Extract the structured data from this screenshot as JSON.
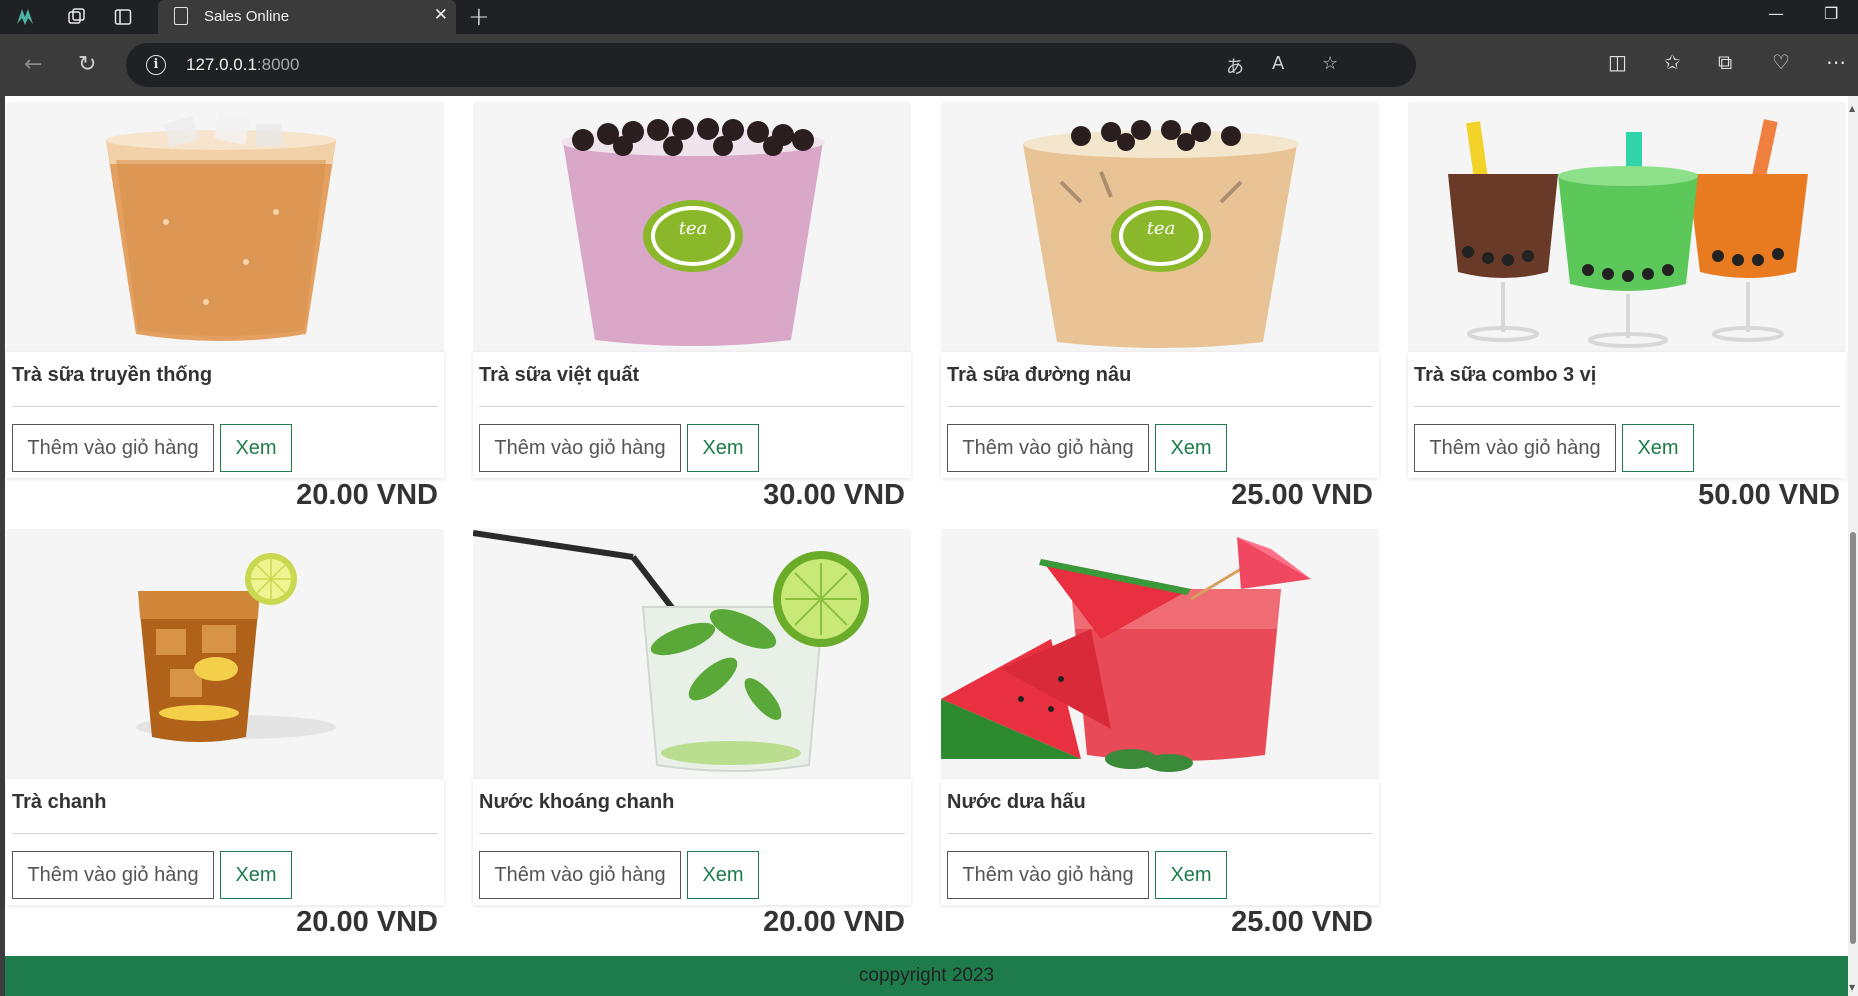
{
  "browser": {
    "tab_title": "Sales Online",
    "url_host": "127.0.0.1",
    "url_port": ":8000"
  },
  "products": [
    {
      "name": "Trà sữa truyền thống",
      "add_label": "Thêm vào giỏ hàng",
      "view_label": "Xem",
      "price": "20.00 VND"
    },
    {
      "name": "Trà sữa việt quất",
      "add_label": "Thêm vào giỏ hàng",
      "view_label": "Xem",
      "price": "30.00 VND"
    },
    {
      "name": "Trà sữa đường nâu",
      "add_label": "Thêm vào giỏ hàng",
      "view_label": "Xem",
      "price": "25.00 VND"
    },
    {
      "name": "Trà sữa combo 3 vị",
      "add_label": "Thêm vào giỏ hàng",
      "view_label": "Xem",
      "price": "50.00 VND"
    },
    {
      "name": "Trà chanh",
      "add_label": "Thêm vào giỏ hàng",
      "view_label": "Xem",
      "price": "20.00 VND"
    },
    {
      "name": "Nước khoáng chanh",
      "add_label": "Thêm vào giỏ hàng",
      "view_label": "Xem",
      "price": "20.00 VND"
    },
    {
      "name": "Nước dưa hấu",
      "add_label": "Thêm vào giỏ hàng",
      "view_label": "Xem",
      "price": "25.00 VND"
    }
  ],
  "footer": {
    "text": "coppyright 2023"
  },
  "colors": {
    "accent_green": "#1e7b4c",
    "text_dark": "#333333"
  }
}
